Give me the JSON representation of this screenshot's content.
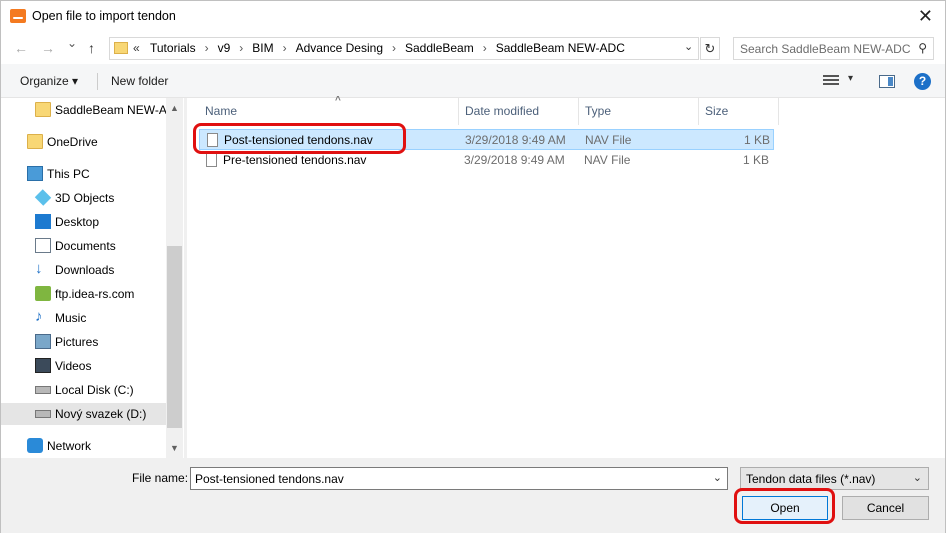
{
  "window": {
    "title": "Open file to import tendon",
    "close_glyph": "✕"
  },
  "nav": {
    "back_glyph": "←",
    "forward_glyph": "→",
    "recent_glyph": "⌄",
    "up_glyph": "↑",
    "address_chevron": "«",
    "breadcrumb": [
      "Tutorials",
      "v9",
      "BIM",
      "Advance Desing",
      "SaddleBeam",
      "SaddleBeam NEW-ADC"
    ],
    "breadcrumb_sep": "›",
    "address_dropdown_glyph": "⌄",
    "refresh_glyph": "↻",
    "search_placeholder": "Search SaddleBeam NEW-ADC",
    "search_glyph": "⚲"
  },
  "toolbar": {
    "organize_label": "Organize ▾",
    "new_folder_label": "New folder",
    "view_dropdown_glyph": "▾",
    "help_glyph": "?"
  },
  "sidebar": {
    "scroll_up_glyph": "▲",
    "scroll_down_glyph": "▼",
    "items": [
      {
        "label": "SaddleBeam NEW-AD",
        "icon": "folder-icon"
      },
      {
        "label": "OneDrive",
        "icon": "folder-icon"
      },
      {
        "label": "This PC",
        "icon": "computer-icon"
      },
      {
        "label": "3D Objects",
        "icon": "3d-objects-icon"
      },
      {
        "label": "Desktop",
        "icon": "desktop-icon"
      },
      {
        "label": "Documents",
        "icon": "documents-icon"
      },
      {
        "label": "Downloads",
        "icon": "downloads-icon"
      },
      {
        "label": "ftp.idea-rs.com",
        "icon": "network-drive-icon"
      },
      {
        "label": "Music",
        "icon": "music-icon"
      },
      {
        "label": "Pictures",
        "icon": "pictures-icon"
      },
      {
        "label": "Videos",
        "icon": "videos-icon"
      },
      {
        "label": "Local Disk (C:)",
        "icon": "disk-icon"
      },
      {
        "label": "Nový svazek (D:)",
        "icon": "disk-icon",
        "selected": true
      },
      {
        "label": "Network",
        "icon": "network-icon"
      }
    ]
  },
  "filelist": {
    "sort_glyph": "^",
    "columns": [
      "Name",
      "Date modified",
      "Type",
      "Size"
    ],
    "rows": [
      {
        "name": "Post-tensioned tendons.nav",
        "date": "3/29/2018 9:49 AM",
        "type": "NAV File",
        "size": "1 KB",
        "selected": true
      },
      {
        "name": "Pre-tensioned tendons.nav",
        "date": "3/29/2018 9:49 AM",
        "type": "NAV File",
        "size": "1 KB",
        "selected": false
      }
    ]
  },
  "footer": {
    "file_name_label": "File name:",
    "file_name_value": "Post-tensioned tendons.nav",
    "dropdown_glyph": "⌄",
    "filter_value": "Tendon data files (*.nav)",
    "open_label": "Open",
    "cancel_label": "Cancel"
  },
  "colors": {
    "highlight_annotation": "#e01010",
    "selection_bg": "#cce8ff",
    "accent": "#0078d7"
  }
}
